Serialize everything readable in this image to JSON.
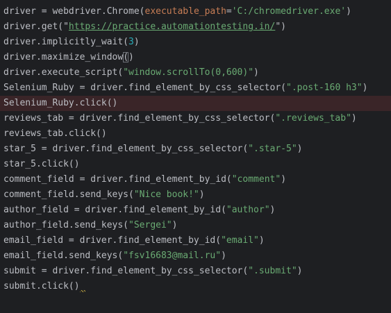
{
  "editor": {
    "lines": [
      {
        "parts": [
          "driver = webdriver.Chrome(",
          "executable_path",
          "=",
          "'C:/chromedriver.exe'",
          ")"
        ]
      },
      {
        "parts": [
          "driver.get(\"",
          "https://practice.automationtesting.in/",
          "\")"
        ]
      },
      {
        "parts": [
          "driver.implicitly_wait(",
          "3",
          ")"
        ]
      },
      {
        "parts": [
          "driver.maximize_window",
          "(",
          ")"
        ]
      },
      {
        "parts": [
          "driver.execute_script(",
          "\"window.scrollTo(0,600)\"",
          ")"
        ]
      },
      {
        "parts": [
          "Selenium_Ruby = driver.find_element_by_css_selector(",
          "\".post-160 h3\"",
          ")"
        ]
      },
      {
        "parts": [
          "Selenium_Ruby.click()"
        ]
      },
      {
        "parts": [
          "reviews_tab = driver.find_element_by_css_selector(",
          "\".reviews_tab\"",
          ")"
        ]
      },
      {
        "parts": [
          "reviews_tab.click()"
        ]
      },
      {
        "parts": [
          "star_5 = driver.find_element_by_css_selector(",
          "\".star-5\"",
          ")"
        ]
      },
      {
        "parts": [
          "star_5.click()"
        ]
      },
      {
        "parts": [
          "comment_field = driver.find_element_by_id(",
          "\"comment\"",
          ")"
        ]
      },
      {
        "parts": [
          "comment_field.send_keys(",
          "\"Nice book!\"",
          ")"
        ]
      },
      {
        "parts": [
          "author_field = driver.find_element_by_id(",
          "\"author\"",
          ")"
        ]
      },
      {
        "parts": [
          "author_field.send_keys(",
          "\"Sergei\"",
          ")"
        ]
      },
      {
        "parts": [
          "email_field = driver.find_element_by_id(",
          "\"email\"",
          ")"
        ]
      },
      {
        "parts": [
          "email_field.send_keys(",
          "\"fsv16683@mail.ru\"",
          ")"
        ]
      },
      {
        "parts": [
          "submit = driver.find_element_by_css_selector(",
          "\".submit\"",
          ")"
        ]
      },
      {
        "parts": [
          "submit.click()"
        ]
      }
    ],
    "colors": {
      "background": "#1e1f22",
      "text": "#bcbec4",
      "string": "#6aab73",
      "parameter": "#c77d55",
      "number": "#2aacb8",
      "highlighted_line": "#3a2528"
    }
  }
}
